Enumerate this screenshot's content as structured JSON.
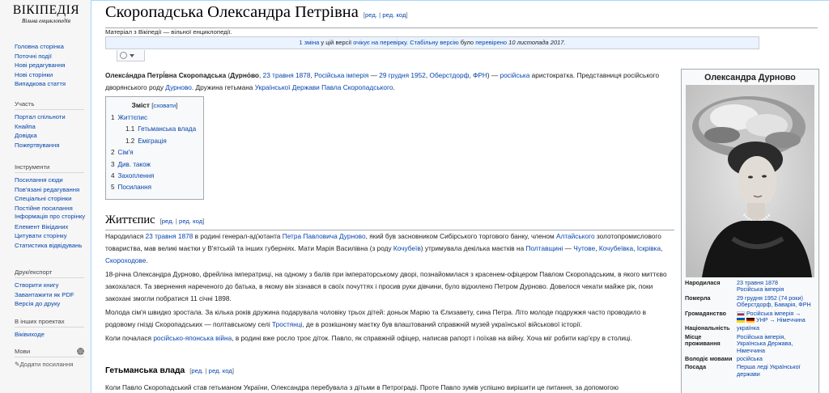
{
  "logo": {
    "wordmark": "ВІКІПЕДІЯ",
    "tagline": "Вільна енциклопедія"
  },
  "sidebar": {
    "nav": [
      "Головна сторінка",
      "Поточні події",
      "Нові редагування",
      "Нові сторінки",
      "Випадкова стаття"
    ],
    "participate": {
      "heading": "Участь",
      "items": [
        "Портал спільноти",
        "Кнайпа",
        "Довідка",
        "Пожертвування"
      ]
    },
    "tools": {
      "heading": "Інструменти",
      "items": [
        "Посилання сюди",
        "Пов'язані редагування",
        "Спеціальні сторінки",
        "Постійне посилання",
        "Інформація про сторінку",
        "Елемент Вікіданих",
        "Цитувати сторінку",
        "Статистика відвідувань"
      ]
    },
    "print": {
      "heading": "Друк/експорт",
      "items": [
        "Створити книгу",
        "Завантажити як PDF",
        "Версія до друку"
      ]
    },
    "other": {
      "heading": "В інших проектах",
      "items": [
        "Віківиходе"
      ]
    },
    "languages": {
      "heading": "Мови",
      "add_links": "✎Додати посилання"
    }
  },
  "article": {
    "title": "Скоропадська Олександра Петрівна",
    "edit": "ред.",
    "edit_code": "ред. код",
    "site_sub": "Матеріал з Вікіпедії — вільної енциклопедії.",
    "revision_notice": {
      "link1": "1 зміна",
      "text1": " у цій версії ",
      "link2": "очікує на перевірку",
      "text2": ". ",
      "link3": "Стабільну версію",
      "text3": " було ",
      "link4": "перевірено",
      "text4": " 10 листопада 2017."
    },
    "lead": {
      "b1": "Олекса́ндра Петрі́вна Скоропадська",
      "t1": " (",
      "b2": "Дурно́во",
      "t2": ", ",
      "l1": "23 травня",
      "t3": " ",
      "l2": "1878",
      "t4": ", ",
      "l3": "Російська імперія",
      "t5": " — ",
      "l4": "29 грудня",
      "t6": " ",
      "l5": "1952",
      "t7": ", ",
      "l6": "Оберстдорф",
      "t8": ", ",
      "l7": "ФРН",
      "t9": ") — ",
      "l8": "російська",
      "t10": " аристократка. Представниця російського дворянського роду ",
      "l9": "Дурново",
      "t11": ". Дружина гетьмана ",
      "l10": "Української Держави",
      "t12": " ",
      "l11": "Павла Скоропадського",
      "t13": "."
    },
    "toc": {
      "title": "Зміст",
      "hide": "сховати",
      "items": [
        {
          "num": "1",
          "label": "Життєпис"
        },
        {
          "num": "1.1",
          "label": "Гетьманська влада"
        },
        {
          "num": "1.2",
          "label": "Еміграція"
        },
        {
          "num": "2",
          "label": "Сім'я"
        },
        {
          "num": "3",
          "label": "Див. також"
        },
        {
          "num": "4",
          "label": "Захоплення"
        },
        {
          "num": "5",
          "label": "Посилання"
        }
      ]
    },
    "section1": {
      "heading": "Життєпис",
      "p1": {
        "t1": "Народилася ",
        "l1": "23 травня",
        "t2": " ",
        "l2": "1878",
        "t3": " в родині генерал-ад'ютанта ",
        "l3": "Петра Павловича Дурново",
        "t4": ", який був засновником Сибірського торгового банку, членом ",
        "l4": "Алтайського",
        "t5": " золотопромислового товариства, мав великі маєтки у В'ятській та інших губерніях. Мати Марія Василівна (з роду ",
        "l5": "Кочубеїв",
        "t6": ") утримувала декілька маєтків на ",
        "l6": "Полтавщині",
        "t7": " — ",
        "l7": "Чутове",
        "t8": ", ",
        "l8": "Кочубеївка",
        "t9": ", ",
        "l9": "Іскрівка",
        "t10": ", ",
        "l10": "Скороходове",
        "t11": "."
      },
      "p2": "18-річна Олександра Дурново, фрейліна імператриці, на одному з балів при імператорському дворі, познайомилася з красенем-офіцером Павлом Скоропадським, в якого миттєво закохалася. Та звернення нареченого до батька, в якому він зізнався в своїх почуттях і просив руки дівчини, було відхилено Петром Дурново. Довелося чекати майже рік, поки закохані змогли побратися 11 січні 1898.",
      "p3": {
        "t1": "Молода сім'я швидко зростала. За кілька років дружина подарувала чоловіку трьох дітей: доньок Марію та Єлизавету, сина Петра. Літо молоде подружжя часто проводило в родовому гнізді Скоропадських — полтавському селі ",
        "l1": "Тростянці",
        "t2": ", де в розкішному маєтку був влаштований справжній музей української військової історії."
      },
      "p4": {
        "t1": "Коли почалася ",
        "l1": "російсько-японська війна",
        "t2": ", в родині вже росло троє діток. Павло, як справжній офіцер, написав рапорт і поїхав на війну. Хоча міг робити кар'єру в столиці."
      }
    },
    "subsection": {
      "heading": "Гетьманська влада",
      "p1": "Коли Павло Скоропадський став гетьманом України, Олександра перебувала з дітьми в Петрограді. Проте Павло зумів успішно вирішити це питання, за допомогою"
    }
  },
  "infobox": {
    "title": "Олександра Дурново",
    "rows": [
      {
        "label": "Народилася",
        "lines": [
          "23 травня 1878",
          "Російська імперія"
        ]
      },
      {
        "label": "Померла",
        "lines": [
          "29 грудня 1952 (74 роки)",
          "Оберстдорф, Баварія, ФРН"
        ]
      },
      {
        "label": "Громадянство",
        "lines": [
          "Російська імперія →",
          "УНР → Німеччина"
        ]
      },
      {
        "label": "Національність",
        "lines": [
          "українка"
        ]
      },
      {
        "label": "Місце проживання",
        "lines": [
          "Російська імперія,",
          "Українська Держава,",
          "Німеччина"
        ]
      },
      {
        "label": "Володіє мовами",
        "lines": [
          "російська"
        ]
      },
      {
        "label": "Посада",
        "lines": [
          "Перша леді Української",
          "держави"
        ]
      }
    ]
  }
}
